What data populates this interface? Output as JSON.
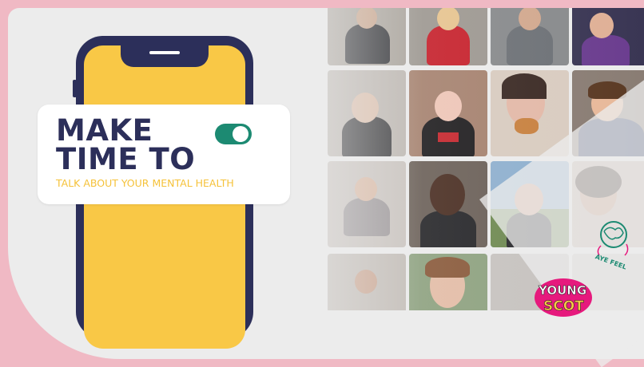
{
  "headline": {
    "line1": "MAKE",
    "line2": "TIME TO"
  },
  "subtitle": "TALK ABOUT YOUR MENTAL HEALTH",
  "toggle": {
    "state": "on"
  },
  "icons": [
    "phone-mockup",
    "toggle-switch",
    "aye-feel-logo",
    "young-scot-logo"
  ],
  "colors": {
    "background_pink": "#f0b9c4",
    "card_grey": "#ececec",
    "phone_navy": "#2c2f5a",
    "screen_yellow": "#f9c846",
    "toggle_green": "#1c8a72",
    "subtitle_yellow": "#f5c23a",
    "young_scot_magenta": "#e6197d"
  },
  "logos": {
    "young_scot": "YOUNG SCOT",
    "aye_feel": "AYE FEEL"
  }
}
